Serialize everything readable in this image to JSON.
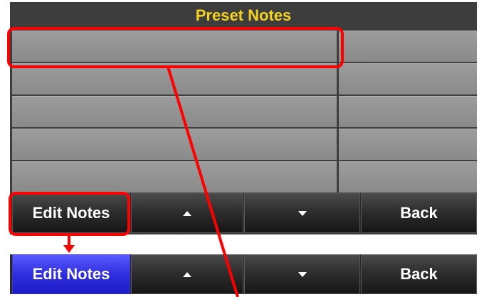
{
  "panel": {
    "title": "Preset Notes",
    "title_color": "#f5d21f",
    "rows": [
      {
        "note": "",
        "value": ""
      },
      {
        "note": "",
        "value": ""
      },
      {
        "note": "",
        "value": ""
      },
      {
        "note": "",
        "value": ""
      },
      {
        "note": "",
        "value": ""
      }
    ]
  },
  "button_bar": {
    "edit_label": "Edit Notes",
    "up_icon": "triangle-up-icon",
    "down_icon": "triangle-down-icon",
    "back_label": "Back"
  },
  "button_bar_active": {
    "edit_label": "Edit Notes",
    "edit_color": "#2f2fe0",
    "up_icon": "triangle-up-icon",
    "down_icon": "triangle-down-icon",
    "back_label": "Back"
  },
  "annotation_color": "#ff0000"
}
